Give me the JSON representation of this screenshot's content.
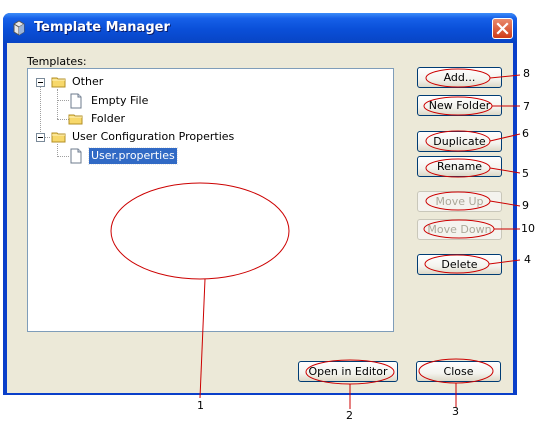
{
  "window": {
    "title": "Template Manager"
  },
  "templates_label": "Templates:",
  "tree": {
    "other": "Other",
    "empty_file": "Empty File",
    "folder": "Folder",
    "user_config": "User Configuration Properties",
    "user_properties": "User.properties"
  },
  "buttons": {
    "add": "Add...",
    "new_folder": "New Folder",
    "duplicate": "Duplicate",
    "rename": "Rename",
    "move_up": "Move Up",
    "move_down": "Move Down",
    "delete": "Delete",
    "open_in_editor": "Open in Editor",
    "close": "Close"
  },
  "callouts": {
    "n1": "1",
    "n2": "2",
    "n3": "3",
    "n4": "4",
    "n5": "5",
    "n6": "6",
    "n7": "7",
    "n8": "8",
    "n9": "9",
    "n10": "10"
  },
  "colors": {
    "titlebar": "#0a4fd8",
    "client_bg": "#ece9d8",
    "selection": "#316ac5",
    "annotation": "#cc0000"
  }
}
